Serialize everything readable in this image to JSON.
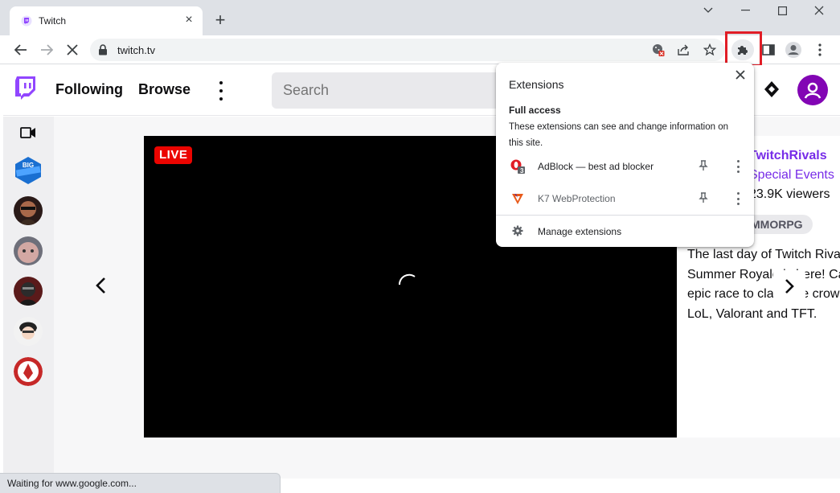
{
  "browser": {
    "tab": {
      "title": "Twitch",
      "close_glyph": "×"
    },
    "new_tab_glyph": "+",
    "omnibox": {
      "url": "twitch.tv"
    },
    "status_text": "Waiting for www.google.com..."
  },
  "twitch": {
    "nav": {
      "following": "Following",
      "browse": "Browse"
    },
    "search": {
      "placeholder": "Search"
    },
    "player": {
      "live_label": "LIVE"
    },
    "info": {
      "channel": "TwitchRivals",
      "category": "Special Events",
      "viewers": "23.9K viewers",
      "tag": "MMORPG",
      "description": "The last day of Twitch Rivals Riot Summer Royale is here! Catch the epic race to claim the crown across LoL, Valorant and TFT."
    },
    "colors": {
      "brand": "#9146ff",
      "live": "#eb0400"
    }
  },
  "extensions_popup": {
    "title": "Extensions",
    "section_title": "Full access",
    "section_note": "These extensions can see and change information on this site.",
    "items": [
      {
        "name": "AdBlock — best ad blocker",
        "icon": "adblock-icon",
        "badge": "3"
      },
      {
        "name": "K7 WebProtection",
        "icon": "k7-icon"
      }
    ],
    "manage_label": "Manage extensions"
  }
}
